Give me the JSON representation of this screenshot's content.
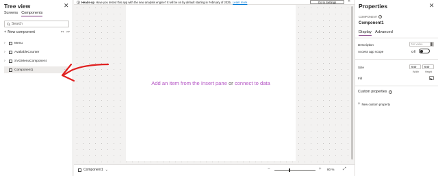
{
  "tree": {
    "title": "Tree view",
    "close": "✕",
    "tabs": [
      "Screens",
      "Components"
    ],
    "search_placeholder": "Search",
    "new_component": "New component",
    "items": [
      {
        "label": "Menu"
      },
      {
        "label": "AvailableCounter"
      },
      {
        "label": "SVGMenuComponent"
      },
      {
        "label": "Component1",
        "selected": true
      }
    ],
    "more": "···"
  },
  "banner": {
    "heading": "Heads-up",
    "message": "Have you tested this app with the new analysis engine? It will be on by default starting in February of 2025.",
    "learn_more": "Learn more",
    "button": "Go to Settings",
    "close": "✕"
  },
  "canvas": {
    "placeholder_a": "Add an item from the Insert pane",
    "placeholder_or": "or",
    "placeholder_b": "connect to data"
  },
  "bottombar": {
    "component": "Component1",
    "zoom_percent": 80,
    "zoom_label": "80",
    "zoom_unit": "%"
  },
  "properties": {
    "title": "Properties",
    "close": "✕",
    "kind": "COMPONENT",
    "name": "Component1",
    "tabs": [
      "Display",
      "Advanced"
    ],
    "description_label": "Description",
    "description_placeholder": "No value",
    "access_label": "Access app scope",
    "access_value": "Off",
    "size_label": "Size",
    "width": "640",
    "height": "640",
    "width_caption": "Width",
    "height_caption": "Height",
    "fill_label": "Fill",
    "custom_props": "Custom properties",
    "new_custom": "New custom property"
  },
  "colors": {
    "accent": "#742774",
    "placeholder": "#b455c4",
    "annotation": "#e02020"
  }
}
